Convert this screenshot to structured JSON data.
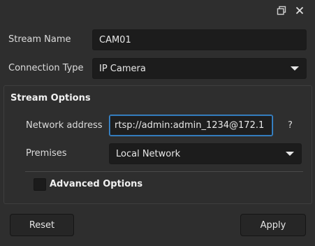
{
  "window": {
    "float_icon": "float-window-icon",
    "close_icon": "close-icon"
  },
  "stream_name": {
    "label": "Stream Name",
    "value": "CAM01"
  },
  "connection_type": {
    "label": "Connection Type",
    "value": "IP Camera",
    "icon": "chevron-down-icon"
  },
  "stream_options": {
    "title": "Stream Options",
    "network_address": {
      "label": "Network address",
      "value": "rtsp://admin:admin_1234@172.1",
      "help": "?"
    },
    "premises": {
      "label": "Premises",
      "value": "Local Network",
      "icon": "chevron-down-icon"
    },
    "advanced": {
      "label": "Advanced Options",
      "checked": false
    }
  },
  "buttons": {
    "reset": "Reset",
    "apply": "Apply"
  },
  "colors": {
    "background": "#2e2e2e",
    "field": "#1c1c1c",
    "focus": "#3d8fd6"
  }
}
